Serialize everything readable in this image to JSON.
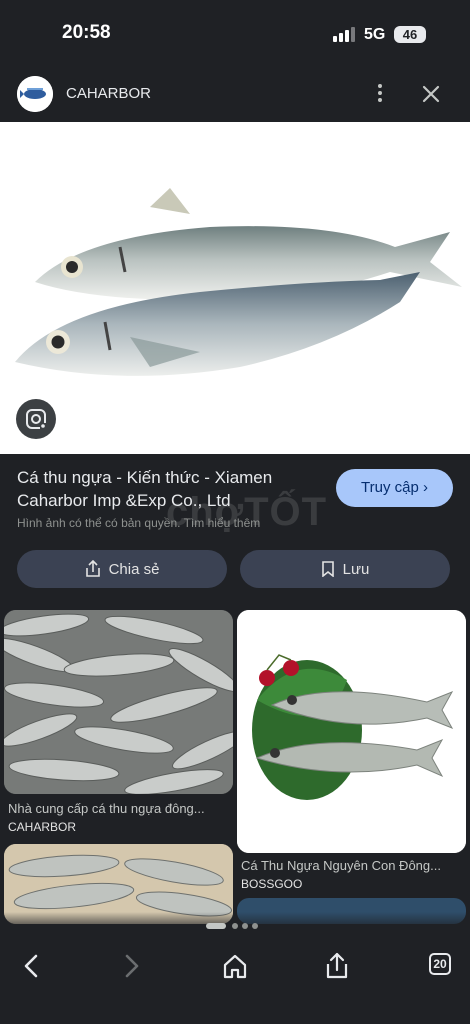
{
  "status_bar": {
    "time": "20:58",
    "network": "5G",
    "battery": "46"
  },
  "header": {
    "site_name": "CAHARBOR"
  },
  "result": {
    "title": "Cá thu ngựa - Kiến thức - Xiamen Caharbor Imp &Exp Co., Ltd",
    "visit_label": "Truy cập",
    "copyright_note": "Hình ảnh có thể có bản quyền. Tìm hiểu thêm",
    "watermark": "chợTỐT"
  },
  "actions": {
    "share_label": "Chia sẻ",
    "save_label": "Lưu"
  },
  "related": [
    {
      "caption": "Nhà cung cấp cá thu ngựa đông...",
      "source": "CAHARBOR"
    },
    {
      "caption": "Cá Thu Ngựa Nguyên Con Đông...",
      "source": "BOSSGOO"
    }
  ],
  "nav": {
    "tab_count": "20"
  },
  "icons": [
    "more-vert-icon",
    "close-icon",
    "lens-icon",
    "share-icon",
    "bookmark-icon",
    "chevron-right-icon",
    "back-icon",
    "forward-icon",
    "home-icon",
    "tabs-icon"
  ],
  "colors": {
    "background": "#1f2125",
    "accent": "#a8c7fa",
    "chip": "#3b4253"
  }
}
